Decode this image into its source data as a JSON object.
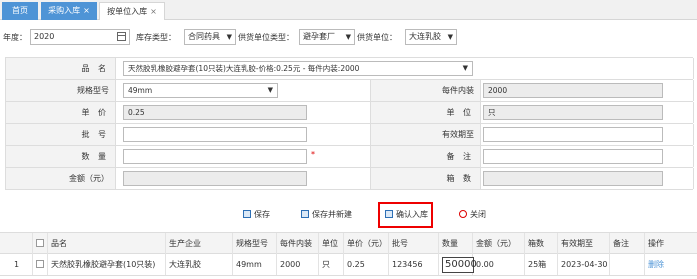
{
  "tabs": {
    "home": "首页",
    "inbound": "采购入库",
    "unit_inbound": "按单位入库",
    "close_glyph": "×"
  },
  "filter": {
    "year_label": "年度：",
    "year_value": "2020",
    "stock_type_label": "库存类型：",
    "stock_type_value": "合同药具",
    "supplier_type_label": "供货单位类型：",
    "supplier_type_value": "避孕套厂",
    "supplier_label": "供货单位：",
    "supplier_value": "大连乳胶"
  },
  "form": {
    "product_label": "品 名",
    "product_value": "天然胶乳橡胶避孕套(10只装)大连乳胶-价格:0.25元 - 每件内装:2000",
    "spec_label": "规格型号",
    "spec_value": "49mm",
    "pack_label": "每件内装",
    "pack_value": "2000",
    "price_label": "单 价",
    "price_value": "0.25",
    "unit_label": "单 位",
    "unit_value": "只",
    "batch_label": "批 号",
    "batch_value": "",
    "expiry_label": "有效期至",
    "expiry_value": "",
    "qty_label": "数 量",
    "qty_value": "",
    "required_mark": "*",
    "remark_label": "备 注",
    "remark_value": "",
    "amount_label": "金额（元）",
    "amount_value": "",
    "cases_label": "箱 数",
    "cases_value": ""
  },
  "buttons": {
    "save": "保存",
    "save_new": "保存并新建",
    "confirm_inbound": "确认入库",
    "close": "关闭"
  },
  "table": {
    "headers": [
      "品名",
      "生产企业",
      "规格型号",
      "每件内装",
      "单位",
      "单价（元）",
      "批号",
      "数量",
      "金额（元）",
      "箱数",
      "有效期至",
      "备注",
      "操作"
    ],
    "rows": [
      {
        "index": "1",
        "product": "天然胶乳橡胶避孕套(10只装)",
        "maker": "大连乳胶",
        "spec": "49mm",
        "pack": "2000",
        "unit": "只",
        "price": "0.25",
        "batch": "123456",
        "qty": "50000",
        "amount": "0.00",
        "cases": "25箱",
        "expiry": "2023-04-30",
        "remark": "",
        "action": "删除"
      }
    ]
  },
  "icons": {
    "dropdown_arrow": "▼"
  },
  "colors": {
    "tab_active_bg": "#4e94d6",
    "highlight_border": "#e00000",
    "link": "#4e94d6"
  }
}
